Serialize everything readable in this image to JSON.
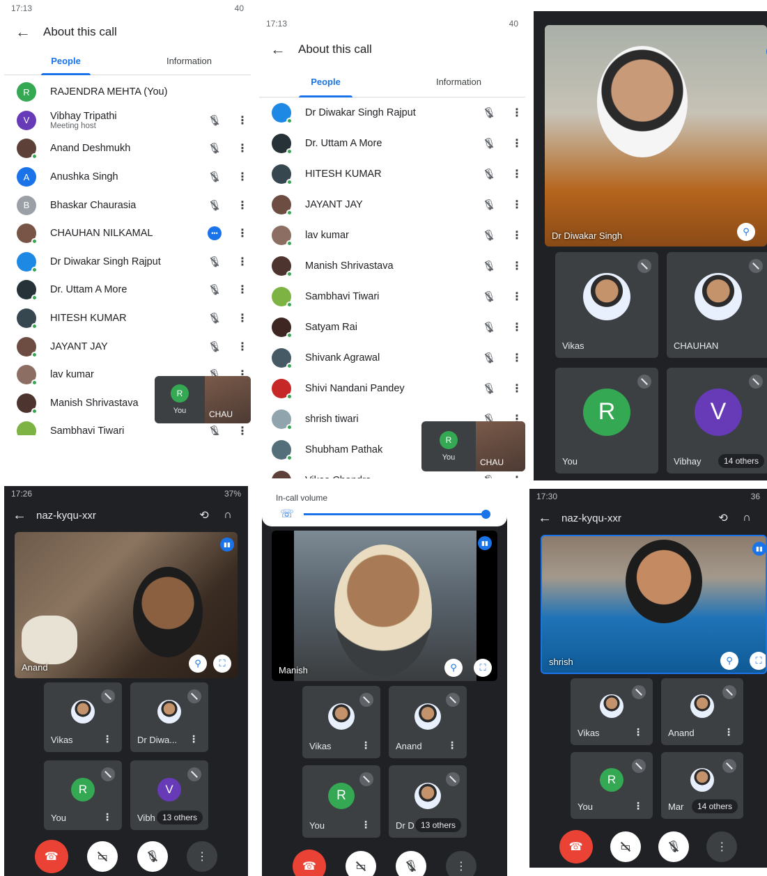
{
  "colors": {
    "accent": "#1a73e8",
    "online": "#34a853",
    "hangup": "#ea4335",
    "dark_bg": "#202124",
    "tile_bg": "#3c4043"
  },
  "shot1": {
    "status_time": "17:13",
    "status_right": "40",
    "header_title": "About this call",
    "tabs": [
      "People",
      "Information"
    ],
    "people": [
      {
        "name": "RAJENDRA MEHTA (You)",
        "initial": "R",
        "color": "#34a853",
        "role": "",
        "mic": "none"
      },
      {
        "name": "Vibhay Tripathi",
        "initial": "V",
        "color": "#673ab7",
        "role": "Meeting host",
        "mic": "off"
      },
      {
        "name": "Anand Deshmukh",
        "initial": "",
        "color": "#5d4037",
        "role": "",
        "mic": "off"
      },
      {
        "name": "Anushka Singh",
        "initial": "A",
        "color": "#1a73e8",
        "role": "",
        "mic": "off"
      },
      {
        "name": "Bhaskar Chaurasia",
        "initial": "B",
        "color": "#9aa0a6",
        "role": "",
        "mic": "off"
      },
      {
        "name": "CHAUHAN NILKAMAL",
        "initial": "",
        "color": "#795548",
        "role": "",
        "mic": "speaking"
      },
      {
        "name": "Dr Diwakar Singh Rajput",
        "initial": "",
        "color": "#1e88e5",
        "role": "",
        "mic": "off"
      },
      {
        "name": "Dr. Uttam A More",
        "initial": "",
        "color": "#263238",
        "role": "",
        "mic": "off"
      },
      {
        "name": "HITESH KUMAR",
        "initial": "",
        "color": "#37474f",
        "role": "",
        "mic": "off"
      },
      {
        "name": "JAYANT JAY",
        "initial": "",
        "color": "#6d4c41",
        "role": "",
        "mic": "off"
      },
      {
        "name": "lav kumar",
        "initial": "",
        "color": "#8d6e63",
        "role": "",
        "mic": "off"
      },
      {
        "name": "Manish Shrivastava",
        "initial": "",
        "color": "#4e342e",
        "role": "",
        "mic": "off"
      },
      {
        "name": "Sambhavi Tiwari",
        "initial": "",
        "color": "#7cb342",
        "role": "",
        "mic": "off"
      }
    ],
    "pip": {
      "me_initial": "R",
      "me_label": "You",
      "other_label": "CHAU"
    }
  },
  "shot2": {
    "status_time": "17:13",
    "status_right": "40",
    "header_title": "About this call",
    "tabs": [
      "People",
      "Information"
    ],
    "people": [
      {
        "name": "Dr Diwakar Singh Rajput",
        "color": "#1e88e5"
      },
      {
        "name": "Dr. Uttam A More",
        "color": "#263238"
      },
      {
        "name": "HITESH KUMAR",
        "color": "#37474f"
      },
      {
        "name": "JAYANT JAY",
        "color": "#6d4c41"
      },
      {
        "name": "lav kumar",
        "color": "#8d6e63"
      },
      {
        "name": "Manish Shrivastava",
        "color": "#4e342e"
      },
      {
        "name": "Sambhavi Tiwari",
        "color": "#7cb342"
      },
      {
        "name": "Satyam Rai",
        "color": "#3e2723"
      },
      {
        "name": "Shivank Agrawal",
        "color": "#455a64"
      },
      {
        "name": "Shivi Nandani Pandey",
        "color": "#c62828"
      },
      {
        "name": "shrish tiwari",
        "color": "#90a4ae"
      },
      {
        "name": "Shubham Pathak",
        "color": "#546e7a"
      },
      {
        "name": "Vikas Chandra",
        "color": "#5d4037"
      }
    ],
    "pip": {
      "me_initial": "R",
      "me_label": "You",
      "other_label": "CHAU"
    }
  },
  "shot3": {
    "main_label": "Dr Diwakar Singh",
    "tiles": [
      {
        "label": "Vikas",
        "kind": "photo"
      },
      {
        "label": "CHAUHAN",
        "kind": "photo"
      },
      {
        "label": "You",
        "kind": "initial",
        "initial": "R",
        "color": "#34a853"
      },
      {
        "label": "Vibhay",
        "kind": "initial",
        "initial": "V",
        "color": "#673ab7",
        "others": "14 others"
      }
    ]
  },
  "shot4": {
    "status_time": "17:26",
    "status_right": "37%",
    "meeting_code": "naz-kyqu-xxr",
    "main_label": "Anand",
    "tiles": [
      {
        "label": "Vikas",
        "kind": "photo"
      },
      {
        "label": "Dr Diwa...",
        "kind": "photo"
      },
      {
        "label": "You",
        "kind": "initial",
        "initial": "R",
        "color": "#34a853"
      },
      {
        "label": "Vibh",
        "kind": "initial",
        "initial": "V",
        "color": "#673ab7",
        "others": "13 others"
      }
    ]
  },
  "shot5": {
    "volume_label": "In-call volume",
    "main_label": "Manish",
    "tiles": [
      {
        "label": "Vikas",
        "kind": "photo"
      },
      {
        "label": "Anand",
        "kind": "photo"
      },
      {
        "label": "You",
        "kind": "initial",
        "initial": "R",
        "color": "#34a853"
      },
      {
        "label": "Dr D",
        "kind": "photo",
        "others": "13 others"
      }
    ]
  },
  "shot6": {
    "status_time": "17:30",
    "status_right": "36",
    "meeting_code": "naz-kyqu-xxr",
    "main_label": "shrish",
    "tiles": [
      {
        "label": "Vikas",
        "kind": "photo"
      },
      {
        "label": "Anand",
        "kind": "photo"
      },
      {
        "label": "You",
        "kind": "initial",
        "initial": "R",
        "color": "#34a853"
      },
      {
        "label": "Mar",
        "kind": "photo",
        "others": "14 others"
      }
    ]
  }
}
